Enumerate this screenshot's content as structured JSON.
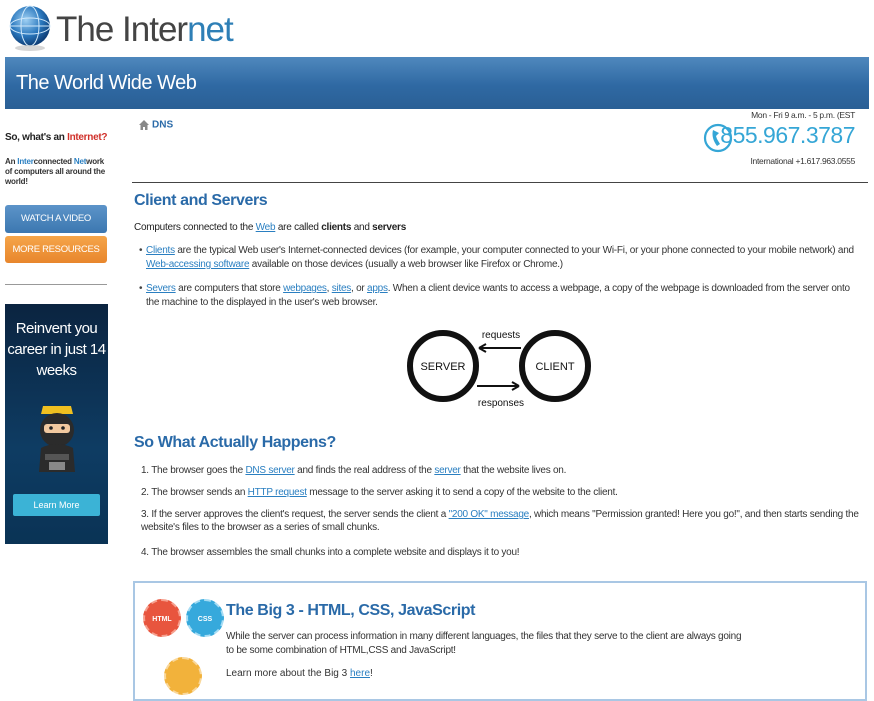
{
  "header": {
    "title_prefix": "The Inter",
    "title_suffix": "net",
    "banner": "The World Wide Web"
  },
  "sidebar": {
    "question_prefix": "So, what's an ",
    "question_highlight": "Internet?",
    "desc": {
      "p1": "An ",
      "h1": "Inter",
      "p2": "connected ",
      "h2": "Net",
      "p3": "work of computers all around the world!"
    },
    "watch_video": "WATCH A VIDEO",
    "more_resources": "MORE RESOURCES",
    "ad": {
      "text": "Reinvent you career in just 14 weeks",
      "button": "Learn More"
    }
  },
  "breadcrumb": {
    "icon": "home-icon",
    "label": "DNS"
  },
  "contact": {
    "hours": "Mon - Fri 9 a.m. - 5 p.m. (EST",
    "phone": "855.967.3787",
    "international": "International +1.617.963.0555",
    "icon": "phone-icon"
  },
  "section1": {
    "heading": "Client and Servers",
    "intro_a": "Computers connected to the ",
    "intro_link": "Web",
    "intro_b": " are called ",
    "intro_bold1": "clients",
    "intro_c": " and ",
    "intro_bold2": "servers",
    "bullet1": {
      "link1": "Clients",
      "t1": " are the typical Web user's Internet-connected devices (for example, your computer connected to your Wi-Fi, or your phone connected to your mobile network) and ",
      "link2": "Web-accessing software",
      "t2": " available on those devices (usually a web browser like Firefox or Chrome.)"
    },
    "bullet2": {
      "link1": "Severs",
      "t1": " are computers that store ",
      "link2": "webpages",
      "t2": ", ",
      "link3": "sites",
      "t3": ", or ",
      "link4": "apps",
      "t4": ". When a client device wants to access a webpage, a copy of the webpage is downloaded from the server onto the machine to the displayed in the user's web browser."
    },
    "diagram": {
      "server": "SERVER",
      "client": "CLIENT",
      "requests": "requests",
      "responses": "responses"
    }
  },
  "section2": {
    "heading": "So What Actually Happens?",
    "step1": {
      "t1": "1. The browser goes the ",
      "link1": "DNS server",
      "t2": " and finds the real address of the ",
      "link2": "server",
      "t3": " that the website lives on."
    },
    "step2": {
      "t1": "2. The browser sends an ",
      "link1": "HTTP request",
      "t2": " message to the server asking it to send a copy of the website to the client."
    },
    "step3": {
      "t1": "3. If the server approves the client's request, the server sends the client a ",
      "link1": "\"200 OK\" message",
      "t2": ", which means \"Permission granted! Here you go!\", and then starts sending the website's files to the browser as a series of small chunks."
    },
    "step4": {
      "t1": "4. The browser assembles the small chunks into a complete website and displays it to you!"
    }
  },
  "big3": {
    "title": "The Big 3 - HTML, CSS, JavaScript",
    "text": "While the server can process information in many different languages, the files that they serve to the client are always going to be some combination of HTML,CSS and JavaScript!",
    "more_a": "Learn more about the Big 3 ",
    "more_link": "here",
    "more_b": "!",
    "badge_html": "HTML",
    "badge_css": "CSS"
  }
}
